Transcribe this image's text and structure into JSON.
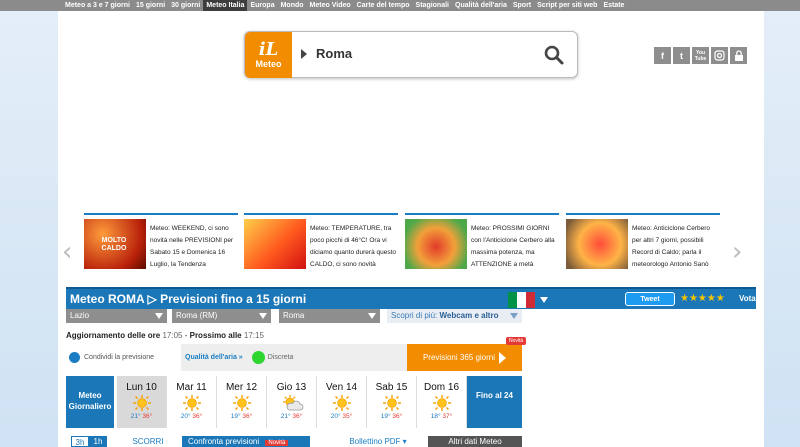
{
  "topnav": {
    "items": [
      "Meteo a 3 e 7 giorni",
      "15 giorni",
      "30 giorni",
      "Meteo Italia",
      "Europa",
      "Mondo",
      "Meteo Video",
      "Carte del tempo",
      "Stagionali",
      "Qualità dell'aria",
      "Sport",
      "Script per siti web",
      "Estate"
    ],
    "active_index": 3
  },
  "header": {
    "logo_il": "iL",
    "logo_meteo": "Meteo",
    "search_value": "Roma",
    "social": [
      "f",
      "t",
      "You Tube",
      "ig",
      "lock"
    ]
  },
  "news": [
    {
      "thumb_label": "MOLTO CALDO",
      "text": "Meteo: WEEKEND, ci sono novità nelle PREVISIONI per Sabato 15 e Domenica 16 Luglio, la Tendenza"
    },
    {
      "thumb_label": "",
      "text": "Meteo: TEMPERATURE, tra poco picchi di 46°C! Ora vi diciamo quanto durerà questo CALDO, ci sono novità"
    },
    {
      "thumb_label": "",
      "text": "Meteo: PROSSIMI GIORNI con l'Anticiclone Cerbero alla massima potenza, ma ATTENZIONE a metà"
    },
    {
      "thumb_label": "",
      "text": "Meteo: Anticiclone Cerbero per altri 7 giorni, possibili Record di Caldo; parla il meteorologo Antonio Sanò"
    }
  ],
  "heading": {
    "title": "Meteo ROMA ▷ Previsioni fino a 15 giorni",
    "tweet": "Tweet",
    "stars": "★★★★★",
    "vote": "Vota!"
  },
  "selects": {
    "region": "Lazio",
    "province": "Roma (RM)",
    "city": "Roma",
    "discover_prefix": "Scopri di più:",
    "discover_value": "Webcam e altro"
  },
  "update": {
    "label1": "Aggiornamento delle ore",
    "time1": "17:05",
    "label2": "Prossimo alle",
    "time2": "17:15"
  },
  "info": {
    "share": "Condividi la previsione",
    "air_label": "Qualità dell'aria »",
    "air_value": "Discreta",
    "forecast_365": "Previsioni 365 giorni",
    "new_badge": "Novità"
  },
  "forecast": {
    "title": "Meteo Giornaliero",
    "end": "Fino al 24",
    "days": [
      {
        "name": "Lun 10",
        "min": "21°",
        "max": "36°",
        "icon": "sun-icon",
        "active": true
      },
      {
        "name": "Mar 11",
        "min": "20°",
        "max": "36°",
        "icon": "sun-icon"
      },
      {
        "name": "Mer 12",
        "min": "19°",
        "max": "36°",
        "icon": "sun-icon"
      },
      {
        "name": "Gio 13",
        "min": "21°",
        "max": "36°",
        "icon": "partly-cloudy-icon"
      },
      {
        "name": "Ven 14",
        "min": "20°",
        "max": "35°",
        "icon": "sun-icon"
      },
      {
        "name": "Sab 15",
        "min": "19°",
        "max": "36°",
        "icon": "sun-icon"
      },
      {
        "name": "Dom 16",
        "min": "18°",
        "max": "37°",
        "icon": "sun-icon"
      }
    ]
  },
  "bottom": {
    "tab_3h": "3h",
    "tab_1h": "1h",
    "scroll_label": "SCORRI",
    "compare": "Confronta previsioni",
    "new": "Novità",
    "bulletin": "Bollettino PDF ▾",
    "other": "Altri dati Meteo"
  },
  "colors": {
    "brand_orange": "#f28c00",
    "brand_blue": "#1b77b7",
    "min_temp": "#1a7dc4",
    "max_temp": "#e53935"
  }
}
